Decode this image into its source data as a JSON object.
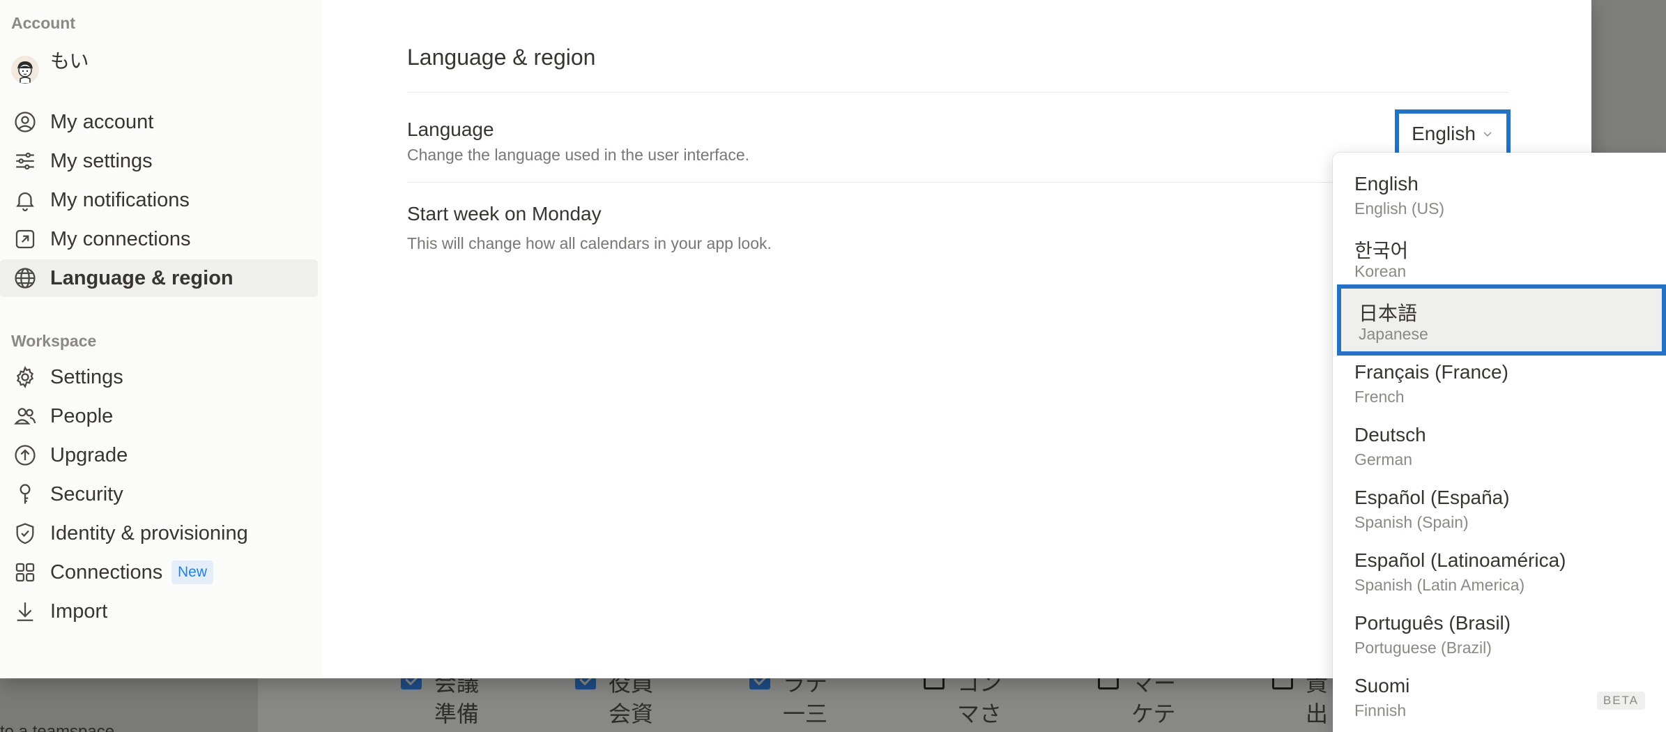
{
  "background": {
    "left_text": "to a teamspace",
    "cards": [
      {
        "top": "会議",
        "bottom": "準備",
        "checked": true
      },
      {
        "top": "役員",
        "bottom": "会資",
        "checked": true
      },
      {
        "top": "ラテ",
        "bottom": "一三",
        "checked": true
      },
      {
        "top": "コン",
        "bottom": "マさ",
        "checked": false
      },
      {
        "top": "マー",
        "bottom": "ケテ",
        "checked": false
      },
      {
        "top": "貴",
        "bottom": "出",
        "checked": false
      }
    ]
  },
  "sidebar": {
    "account_label": "Account",
    "user_name": "もい",
    "account_items": [
      {
        "label": "My account",
        "icon": "user-circle-icon"
      },
      {
        "label": "My settings",
        "icon": "sliders-icon"
      },
      {
        "label": "My notifications",
        "icon": "bell-icon"
      },
      {
        "label": "My connections",
        "icon": "external-link-icon"
      },
      {
        "label": "Language & region",
        "icon": "globe-icon",
        "active": true
      }
    ],
    "workspace_label": "Workspace",
    "workspace_items": [
      {
        "label": "Settings",
        "icon": "gear-icon"
      },
      {
        "label": "People",
        "icon": "people-icon"
      },
      {
        "label": "Upgrade",
        "icon": "upgrade-arrow-icon"
      },
      {
        "label": "Security",
        "icon": "key-icon"
      },
      {
        "label": "Identity & provisioning",
        "icon": "shield-check-icon"
      },
      {
        "label": "Connections",
        "icon": "grid-icon",
        "badge": "New"
      },
      {
        "label": "Import",
        "icon": "download-icon"
      }
    ]
  },
  "content": {
    "title": "Language & region",
    "language": {
      "title": "Language",
      "description": "Change the language used in the user interface.",
      "current_value": "English"
    },
    "week": {
      "title": "Start week on Monday",
      "description": "This will change how all calendars in your app look."
    }
  },
  "dropdown": {
    "options": [
      {
        "name": "English",
        "sub": "English (US)"
      },
      {
        "name": "한국어",
        "sub": "Korean"
      },
      {
        "name": "日本語",
        "sub": "Japanese",
        "selected": true
      },
      {
        "name": "Français (France)",
        "sub": "French"
      },
      {
        "name": "Deutsch",
        "sub": "German"
      },
      {
        "name": "Español (España)",
        "sub": "Spanish (Spain)"
      },
      {
        "name": "Español (Latinoamérica)",
        "sub": "Spanish (Latin America)"
      },
      {
        "name": "Português (Brasil)",
        "sub": "Portuguese (Brazil)"
      },
      {
        "name": "Suomi",
        "sub": "Finnish",
        "badge": "BETA"
      }
    ]
  },
  "colors": {
    "accent": "#2372c6",
    "new_badge_text": "#2383e2",
    "sidebar_bg": "#fbfbfa",
    "active_item_bg": "#efefed"
  }
}
